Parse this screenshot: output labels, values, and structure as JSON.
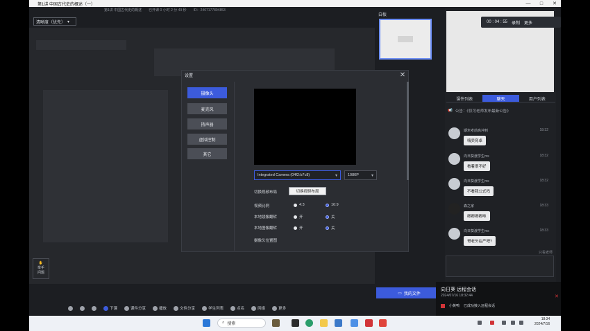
{
  "window": {
    "title": "第1讲 中国古代史的概述（一）",
    "minimize": "—",
    "maximize": "□",
    "close": "✕"
  },
  "top_info": {
    "lesson": "第1讲 中国古代史的概述",
    "time": "已开课 0 小时 2 分 49 秒",
    "id": "ID：2467177894853"
  },
  "quality": {
    "label": "清晰度（优先）",
    "caret": "▾"
  },
  "preview": {
    "label": "白板"
  },
  "recording": {
    "time": "00 : 04 : 55",
    "record_label": "录制",
    "more_label": "更多"
  },
  "right_tabs": [
    {
      "label": "课件列表"
    },
    {
      "label": "聊天",
      "active": true
    },
    {
      "label": "用户列表"
    }
  ],
  "notice": "公告：《仅可老师发布最新公告》",
  "messages": [
    {
      "name": "期末考前高冲刺",
      "time": "18:32",
      "text": "嗨卖育卓"
    },
    {
      "name": "向日葵渡学生ms",
      "time": "18:32",
      "text": "看着很不好"
    },
    {
      "name": "向日葵渡学生ms",
      "time": "18:32",
      "text": "不看我公式吗"
    },
    {
      "name": "森之家",
      "time": "18:33",
      "text": "卿卿卿卿咻"
    },
    {
      "name": "向日葵渡学生ms",
      "time": "18:33",
      "text": "哥老头在产吧?"
    }
  ],
  "only_teacher": "只看老师",
  "dialog": {
    "title": "设置",
    "close": "✕",
    "side_buttons": [
      "摄像头",
      "麦克风",
      "扬声器",
      "虚拟控制",
      "其它"
    ],
    "camera_device": "Integrated Camera (04f2:b7c8)",
    "resolution": "1080P",
    "switch_layout_label": "切换视频布局",
    "switch_layout_button": "切换视频布局",
    "ratio_label": "视频比例",
    "ratio_options": [
      "4:3",
      "16:9"
    ],
    "mirror_label": "本地镜像翻转",
    "mirror_options": [
      "开",
      "关"
    ],
    "flip_label": "本地图像翻转",
    "flip_options": [
      "开",
      "关"
    ],
    "position_label": "摄像头位置图"
  },
  "raise_hand": {
    "icon": "✋",
    "line1": "举手",
    "line2": "问题"
  },
  "my_files": "我的文件",
  "toolbar": [
    "下课",
    "课件分享",
    "播放",
    "文件分享",
    "学生列表",
    "点名",
    "网络",
    "更多"
  ],
  "notification": {
    "title": "向日葵 远程会话",
    "subtitle": "2024/07/16 18:32:44",
    "item": "小黄鸭",
    "detail": "已成功接入远程会话"
  },
  "taskbar": {
    "search": "搜索",
    "time": "18:34",
    "date": "2024/7/16"
  }
}
